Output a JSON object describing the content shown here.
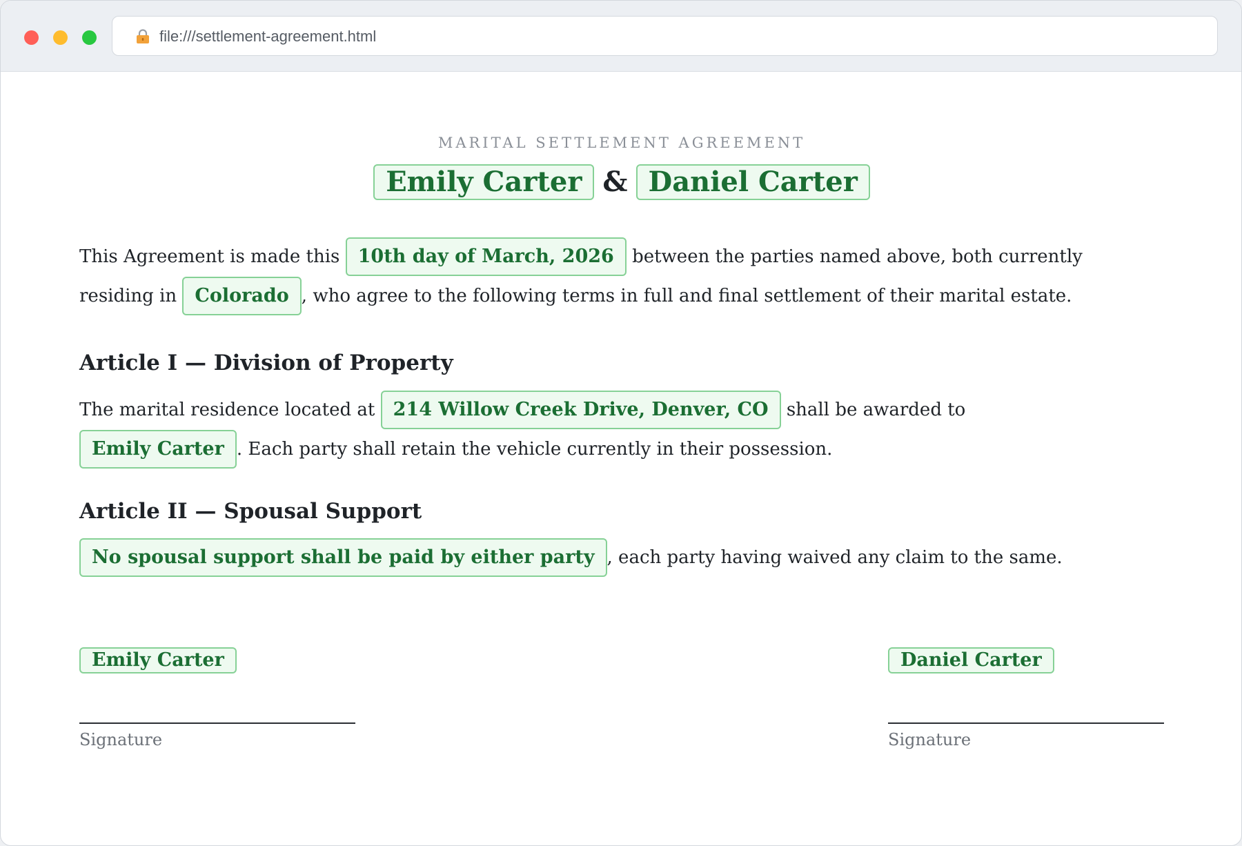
{
  "browser": {
    "url": "file:///settlement-agreement.html",
    "lock_icon": "lock-icon",
    "controls": {
      "close_color": "#ff5f57",
      "minimize_color": "#febc2e",
      "maximize_color": "#28c840"
    }
  },
  "document": {
    "kicker": "MARITAL SETTLEMENT AGREEMENT",
    "party_one": "Emily Carter",
    "ampersand": "&",
    "party_two": "Daniel Carter",
    "intro": {
      "text_1": "This Agreement is made this",
      "date": "10th day of March, 2026",
      "text_2": "between the parties named above, both currently residing in",
      "state": "Colorado",
      "text_3": ", who agree to the following terms in full and final settlement of their marital estate."
    },
    "article_1": {
      "heading": "Article I — Division of Property",
      "text_1": "The marital residence located at",
      "address": "214 Willow Creek Drive, Denver, CO",
      "text_2": "shall be awarded to",
      "awardee": "Emily Carter",
      "text_3": ". Each party shall retain the vehicle currently in their possession."
    },
    "article_2": {
      "heading": "Article II — Spousal Support",
      "clause": "No spousal support shall be paid by either party",
      "text_1": ", each party having waived any claim to the same."
    },
    "signatures": [
      {
        "name": "Emily Carter",
        "label": "Signature"
      },
      {
        "name": "Daniel Carter",
        "label": "Signature"
      }
    ]
  },
  "colors": {
    "chip_background": "#eefaf0",
    "chip_border": "#86d196",
    "chip_text": "#1b6e33"
  }
}
